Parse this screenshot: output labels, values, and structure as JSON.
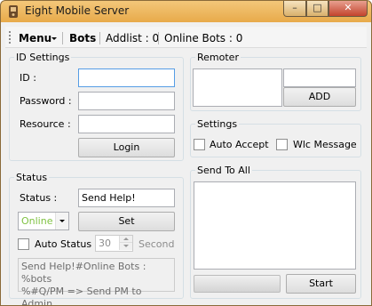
{
  "window": {
    "title": "Eight Mobile Server",
    "min_glyph": "–",
    "max_glyph": "□",
    "close_glyph": "✕"
  },
  "menubar": {
    "menu_label": "Menu",
    "bots_label": "Bots",
    "addlist_label": "Addlist : 0",
    "online_bots_label": "Online Bots : 0"
  },
  "id_settings": {
    "title": "ID Settings",
    "id_label": "ID :",
    "password_label": "Password :",
    "resource_label": "Resource :",
    "id_value": "",
    "password_value": "",
    "resource_value": "",
    "login_label": "Login"
  },
  "status": {
    "title": "Status",
    "status_label": "Status :",
    "status_value": "Send Help!",
    "presence_value": "Online",
    "set_label": "Set",
    "auto_status_label": "Auto Status",
    "auto_status_checked": false,
    "interval_value": "30",
    "second_label": "Second",
    "template_text": "Send Help!#Online Bots : %bots\n%#Q/PM => Send PM to Admin"
  },
  "remoter": {
    "title": "Remoter",
    "input_value": "",
    "add_label": "ADD"
  },
  "settings": {
    "title": "Settings",
    "auto_accept_label": "Auto Accept",
    "auto_accept_checked": false,
    "wlc_message_label": "Wlc Message",
    "wlc_message_checked": false
  },
  "send_to_all": {
    "title": "Send To All",
    "message_value": "",
    "progress": 0,
    "start_label": "Start"
  },
  "colors": {
    "title_bar": "#e8aa4a",
    "close_button": "#c2432c",
    "presence_online": "#7fc242",
    "focus_border": "#569de5"
  },
  "icons": {
    "app": "app-icon",
    "menu_caret": "chevron-down-icon"
  }
}
